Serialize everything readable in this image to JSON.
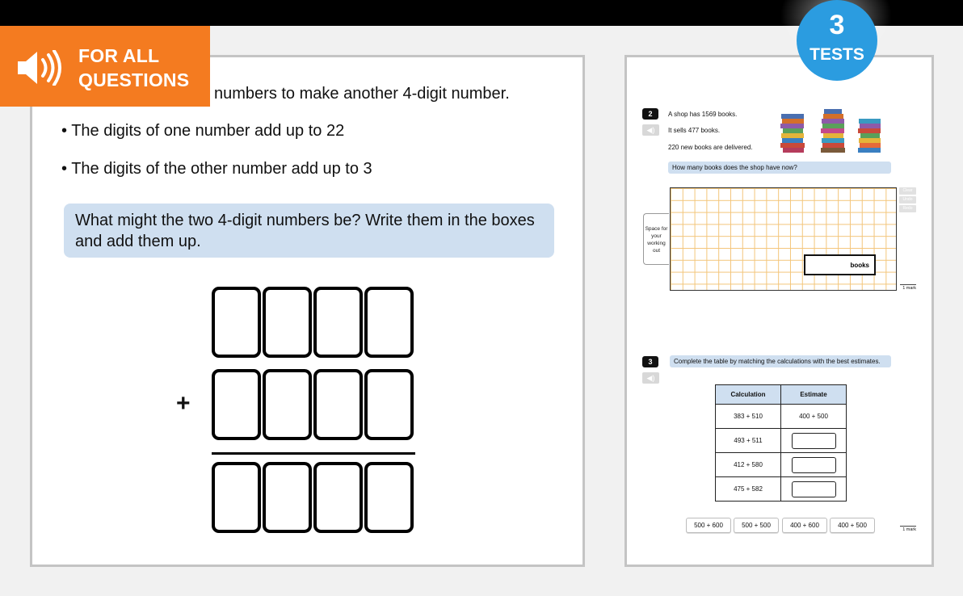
{
  "audio_banner": {
    "label_line1": "FOR ALL",
    "label_line2": "QUESTIONS",
    "icon": "speaker-icon",
    "color": "#f47b20"
  },
  "tests_badge": {
    "number": "3",
    "label": "TESTS",
    "color": "#2b9ce0"
  },
  "left_question": {
    "intro": "numbers to make another 4-digit number.",
    "bullets": [
      "• The digits of one number add up to 22",
      "• The digits of the other number add up to 3"
    ],
    "prompt": "What might the two 4-digit numbers be? Write them in the boxes and add them up.",
    "plus_sign": "+",
    "digit_rows": 3,
    "digits_per_row": 4
  },
  "right_page": {
    "q2": {
      "number": "2",
      "lines": [
        "A shop has 1569 books.",
        "It sells 477 books.",
        "220 new books are delivered."
      ],
      "question": "How many books does the shop have now?",
      "working_label": "Space for your working out",
      "answer_unit": "books",
      "side_buttons": [
        "Clear",
        "Undo",
        "Redo"
      ],
      "mark": "1 mark"
    },
    "q3": {
      "number": "3",
      "question": "Complete the table by matching the calculations with the best estimates.",
      "table_headers": [
        "Calculation",
        "Estimate"
      ],
      "rows": [
        {
          "calc": "383 + 510",
          "estimate": "400 + 500"
        },
        {
          "calc": "493 + 511",
          "estimate": ""
        },
        {
          "calc": "412 + 580",
          "estimate": ""
        },
        {
          "calc": "475 + 582",
          "estimate": ""
        }
      ],
      "choices": [
        "500 + 600",
        "500 + 500",
        "400 + 600",
        "400 + 500"
      ],
      "mark": "1 mark"
    }
  }
}
